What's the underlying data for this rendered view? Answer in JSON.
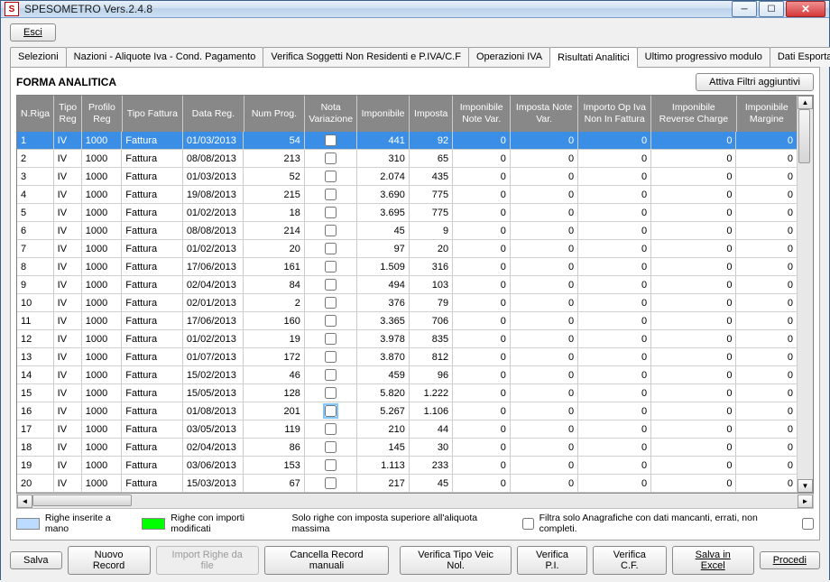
{
  "window": {
    "title": "SPESOMETRO Vers.2.4.8"
  },
  "buttons": {
    "esci": "Esci",
    "attiva_filtri": "Attiva Filtri aggiuntivi",
    "salva": "Salva",
    "nuovo_record": "Nuovo Record",
    "import_righe": "Import Righe da file",
    "cancella_record": "Cancella Record manuali",
    "verifica_tipo": "Verifica Tipo Veic Nol.",
    "verifica_pi": "Verifica P.I.",
    "verifica_cf": "Verifica C.F.",
    "salva_excel": "Salva in Excel",
    "procedi": "Procedi"
  },
  "tabs": [
    "Selezioni",
    "Nazioni - Aliquote Iva - Cond. Pagamento",
    "Verifica Soggetti Non Residenti e P.IVA/C.F",
    "Operazioni IVA",
    "Risultati Analitici",
    "Ultimo progressivo modulo",
    "Dati Esportaz"
  ],
  "active_tab": 4,
  "section_title": "FORMA ANALITICA",
  "columns": [
    "N.Riga",
    "Tipo Reg",
    "Profilo Reg",
    "Tipo Fattura",
    "Data Reg.",
    "Num  Prog.",
    "Nota Variazione",
    "Imponibile",
    "Imposta",
    "Imponibile Note Var.",
    "Imposta Note Var.",
    "Importo Op Iva Non In Fattura",
    "Imponibile Reverse Charge",
    "Imponibile Margine"
  ],
  "rows": [
    {
      "n": "1",
      "tr": "IV",
      "pr": "1000",
      "tf": "Fattura",
      "dr": "01/03/2013",
      "np": "54",
      "imp": "441",
      "tax": "92",
      "inv": "0",
      "itv": "0",
      "iop": "0",
      "irc": "0",
      "im": "0",
      "sel": true
    },
    {
      "n": "2",
      "tr": "IV",
      "pr": "1000",
      "tf": "Fattura",
      "dr": "08/08/2013",
      "np": "213",
      "imp": "310",
      "tax": "65",
      "inv": "0",
      "itv": "0",
      "iop": "0",
      "irc": "0",
      "im": "0"
    },
    {
      "n": "3",
      "tr": "IV",
      "pr": "1000",
      "tf": "Fattura",
      "dr": "01/03/2013",
      "np": "52",
      "imp": "2.074",
      "tax": "435",
      "inv": "0",
      "itv": "0",
      "iop": "0",
      "irc": "0",
      "im": "0"
    },
    {
      "n": "4",
      "tr": "IV",
      "pr": "1000",
      "tf": "Fattura",
      "dr": "19/08/2013",
      "np": "215",
      "imp": "3.690",
      "tax": "775",
      "inv": "0",
      "itv": "0",
      "iop": "0",
      "irc": "0",
      "im": "0"
    },
    {
      "n": "5",
      "tr": "IV",
      "pr": "1000",
      "tf": "Fattura",
      "dr": "01/02/2013",
      "np": "18",
      "imp": "3.695",
      "tax": "775",
      "inv": "0",
      "itv": "0",
      "iop": "0",
      "irc": "0",
      "im": "0"
    },
    {
      "n": "6",
      "tr": "IV",
      "pr": "1000",
      "tf": "Fattura",
      "dr": "08/08/2013",
      "np": "214",
      "imp": "45",
      "tax": "9",
      "inv": "0",
      "itv": "0",
      "iop": "0",
      "irc": "0",
      "im": "0"
    },
    {
      "n": "7",
      "tr": "IV",
      "pr": "1000",
      "tf": "Fattura",
      "dr": "01/02/2013",
      "np": "20",
      "imp": "97",
      "tax": "20",
      "inv": "0",
      "itv": "0",
      "iop": "0",
      "irc": "0",
      "im": "0"
    },
    {
      "n": "8",
      "tr": "IV",
      "pr": "1000",
      "tf": "Fattura",
      "dr": "17/06/2013",
      "np": "161",
      "imp": "1.509",
      "tax": "316",
      "inv": "0",
      "itv": "0",
      "iop": "0",
      "irc": "0",
      "im": "0"
    },
    {
      "n": "9",
      "tr": "IV",
      "pr": "1000",
      "tf": "Fattura",
      "dr": "02/04/2013",
      "np": "84",
      "imp": "494",
      "tax": "103",
      "inv": "0",
      "itv": "0",
      "iop": "0",
      "irc": "0",
      "im": "0"
    },
    {
      "n": "10",
      "tr": "IV",
      "pr": "1000",
      "tf": "Fattura",
      "dr": "02/01/2013",
      "np": "2",
      "imp": "376",
      "tax": "79",
      "inv": "0",
      "itv": "0",
      "iop": "0",
      "irc": "0",
      "im": "0"
    },
    {
      "n": "11",
      "tr": "IV",
      "pr": "1000",
      "tf": "Fattura",
      "dr": "17/06/2013",
      "np": "160",
      "imp": "3.365",
      "tax": "706",
      "inv": "0",
      "itv": "0",
      "iop": "0",
      "irc": "0",
      "im": "0"
    },
    {
      "n": "12",
      "tr": "IV",
      "pr": "1000",
      "tf": "Fattura",
      "dr": "01/02/2013",
      "np": "19",
      "imp": "3.978",
      "tax": "835",
      "inv": "0",
      "itv": "0",
      "iop": "0",
      "irc": "0",
      "im": "0"
    },
    {
      "n": "13",
      "tr": "IV",
      "pr": "1000",
      "tf": "Fattura",
      "dr": "01/07/2013",
      "np": "172",
      "imp": "3.870",
      "tax": "812",
      "inv": "0",
      "itv": "0",
      "iop": "0",
      "irc": "0",
      "im": "0"
    },
    {
      "n": "14",
      "tr": "IV",
      "pr": "1000",
      "tf": "Fattura",
      "dr": "15/02/2013",
      "np": "46",
      "imp": "459",
      "tax": "96",
      "inv": "0",
      "itv": "0",
      "iop": "0",
      "irc": "0",
      "im": "0"
    },
    {
      "n": "15",
      "tr": "IV",
      "pr": "1000",
      "tf": "Fattura",
      "dr": "15/05/2013",
      "np": "128",
      "imp": "5.820",
      "tax": "1.222",
      "inv": "0",
      "itv": "0",
      "iop": "0",
      "irc": "0",
      "im": "0"
    },
    {
      "n": "16",
      "tr": "IV",
      "pr": "1000",
      "tf": "Fattura",
      "dr": "01/08/2013",
      "np": "201",
      "imp": "5.267",
      "tax": "1.106",
      "inv": "0",
      "itv": "0",
      "iop": "0",
      "irc": "0",
      "im": "0",
      "hl": true
    },
    {
      "n": "17",
      "tr": "IV",
      "pr": "1000",
      "tf": "Fattura",
      "dr": "03/05/2013",
      "np": "119",
      "imp": "210",
      "tax": "44",
      "inv": "0",
      "itv": "0",
      "iop": "0",
      "irc": "0",
      "im": "0"
    },
    {
      "n": "18",
      "tr": "IV",
      "pr": "1000",
      "tf": "Fattura",
      "dr": "02/04/2013",
      "np": "86",
      "imp": "145",
      "tax": "30",
      "inv": "0",
      "itv": "0",
      "iop": "0",
      "irc": "0",
      "im": "0"
    },
    {
      "n": "19",
      "tr": "IV",
      "pr": "1000",
      "tf": "Fattura",
      "dr": "03/06/2013",
      "np": "153",
      "imp": "1.113",
      "tax": "233",
      "inv": "0",
      "itv": "0",
      "iop": "0",
      "irc": "0",
      "im": "0"
    },
    {
      "n": "20",
      "tr": "IV",
      "pr": "1000",
      "tf": "Fattura",
      "dr": "15/03/2013",
      "np": "67",
      "imp": "217",
      "tax": "45",
      "inv": "0",
      "itv": "0",
      "iop": "0",
      "irc": "0",
      "im": "0"
    }
  ],
  "legend": {
    "manual": "Righe inserite a mano",
    "modified": "Righe con importi modificati",
    "only_rows": "Solo righe con imposta superiore all'aliquota massima",
    "filter_anag": "Filtra solo Anagrafiche con dati mancanti, errati, non completi."
  }
}
